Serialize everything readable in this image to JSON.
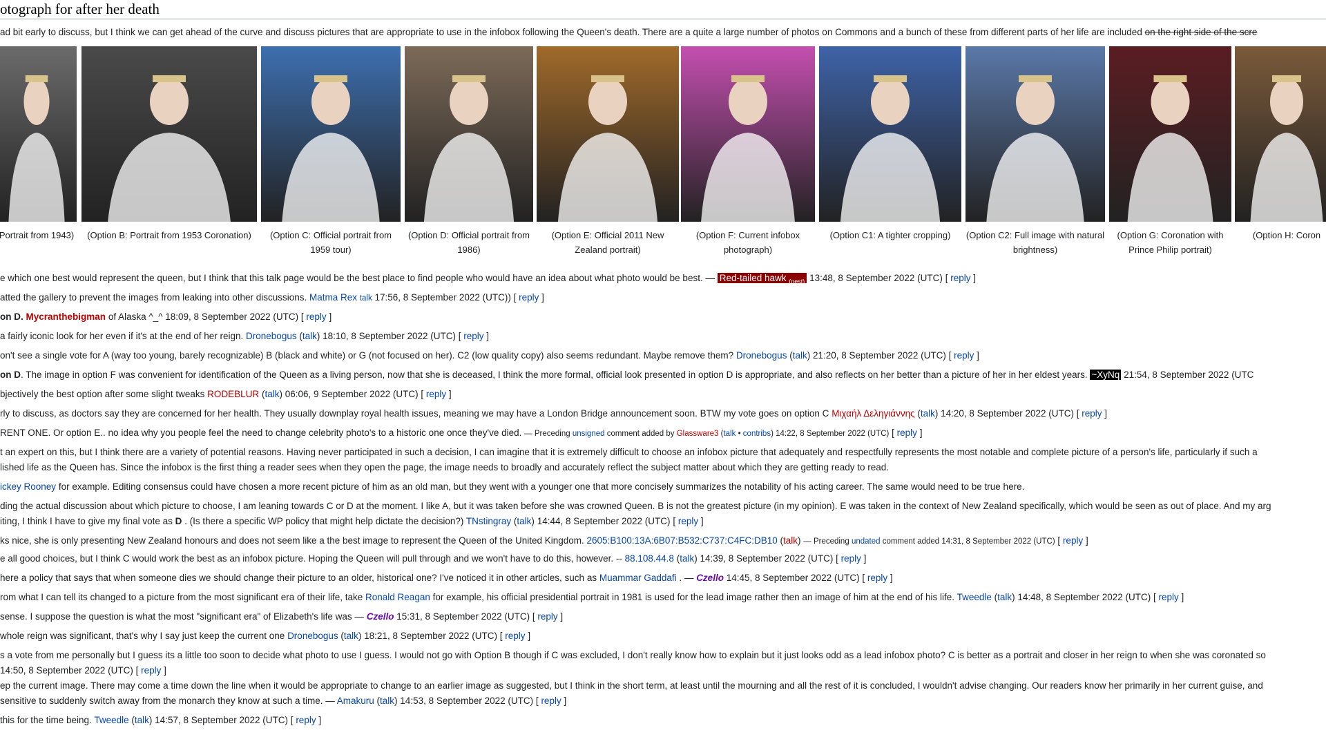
{
  "heading": "otograph for after her death",
  "intro": {
    "text": "ad bit early to discuss, but I think we can get ahead of the curve and discuss pictures that are appropriate to use in the infobox following the Queen's death. There are a quite a large number of photos on Commons and a bunch of these from different parts of her life are included",
    "struck": "on the right side of the scre"
  },
  "gallery": [
    {
      "caption": "Portrait from 1943)",
      "bg": "#6b6b6b"
    },
    {
      "caption": "(Option B: Portrait from 1953 Coronation)",
      "bg": "#4a4a4a"
    },
    {
      "caption": "(Option C: Official portrait from 1959 tour)",
      "bg": "#3d6fb0"
    },
    {
      "caption": "(Option D: Official portrait from 1986)",
      "bg": "#7c6a58"
    },
    {
      "caption": "(Option E: Official 2011 New Zealand portrait)",
      "bg": "#a06a2a"
    },
    {
      "caption": "(Option F: Current infobox photograph)",
      "bg": "#c44fb0"
    },
    {
      "caption": "(Option C1: A tighter cropping)",
      "bg": "#3e63a8"
    },
    {
      "caption": "(Option C2: Full image with natural brightness)",
      "bg": "#5a78a8"
    },
    {
      "caption": "(Option G: Coronation with Prince Philip portrait)",
      "bg": "#5a1d22"
    },
    {
      "caption": "(Option H: Coron",
      "bg": "#7a5a3a"
    }
  ],
  "comments": [
    {
      "text": "e which one best would represent the queen, but I think that this talk page would be the best place to find people who would have an idea about what photo would be best. —",
      "sig": "Red-tailed hawk",
      "sig_sub": "(nest)",
      "time": "13:48, 8 September 2022 (UTC)",
      "reply": "reply"
    },
    {
      "text": "atted the gallery to prevent the images from leaking into other discussions.",
      "user": "Matma Rex",
      "talk": "talk",
      "time": "17:56, 8 September 2022 (UTC))",
      "reply": "reply"
    },
    {
      "bold": "on D.",
      "user": "Mycranthebigman",
      "text2": "of Alaska ^_^ 18:09, 8 September 2022 (UTC)",
      "reply": "reply"
    },
    {
      "text": "a fairly iconic look for her even if it's at the end of her reign.",
      "user": "Dronebogus",
      "talk": "talk",
      "time": "18:10, 8 September 2022 (UTC)",
      "reply": "reply"
    },
    {
      "text": "on't see a single vote for A (way too young, barely recognizable) B (black and white) or G (not focused on her). C2 (low quality copy) also seems redundant. Maybe remove them?",
      "user": "Dronebogus",
      "talk": "talk",
      "time": "21:20, 8 September 2022 (UTC)",
      "reply": "reply"
    },
    {
      "bold": "on D",
      "text": ". The image in option F was convenient for identification of the Queen as a living person, now that she is deceased, I think the more formal, official look presented in option D is appropriate, and also reflects on her better than a picture of her in her eldest years.",
      "sig": "~XyNq",
      "time": "21:54, 8 September 2022 (UTC"
    },
    {
      "text": "bjectively the best option after some slight tweaks",
      "user": "RODEBLUR",
      "talk": "talk",
      "time": "06:06, 9 September 2022 (UTC)",
      "reply": "reply"
    },
    {
      "text": "rly to discuss, as doctors say they are concerned for her health. They usually downplay royal health issues, meaning we may have a London Bridge announcement soon. BTW my vote goes on option C",
      "user": "Μιχαήλ Δεληγιάννης",
      "talk": "talk",
      "time": "14:20, 8 September 2022 (UTC)",
      "reply": "reply"
    },
    {
      "text": "RENT ONE. Or option E.. no idea why you people feel the need to change celebrity photo's to a historic one once they've died.",
      "pre": "— Preceding",
      "unsigned": "unsigned",
      "mid": "comment added by",
      "user": "Glassware3",
      "talk": "talk",
      "contribs": "contribs",
      "time": "14:22, 8 September 2022 (UTC)",
      "reply": "reply"
    },
    {
      "text": "t an expert on this, but I think there are a variety of potential reasons. Having never participated in such a decision, I can imagine that it is extremely difficult to choose an infobox picture that adequately and respectfully represents the most notable and complete picture of a person's life, particularly if such a"
    },
    {
      "text": "lished life as the Queen has. Since the infobox is the first thing a reader sees when they open the page, the image needs to broadly and accurately reflect the subject matter about which they are getting ready to read."
    },
    {
      "link": "ickey Rooney",
      "text": "for example. Editing consensus could have chosen a more recent picture of him as an old man, but they went with a younger one that more concisely summarizes the notability of his acting career. The same would need to be true here."
    },
    {
      "text": "ding the actual discussion about which picture to choose, I am leaning towards C or D at the moment. I like A, but it was taken before she was crowned Queen. B is not the greatest picture (in my opinion). E was taken in the context of New Zealand specifically, which would be seen as out of place. And my arg"
    },
    {
      "text": "iting, I think I have to give my final vote as",
      "bold": "D",
      "text2": ". (Is there a specific WP policy that might help dictate the decision?)",
      "user": "TNstingray",
      "talk": "talk",
      "time": "14:44, 8 September 2022 (UTC)",
      "reply": "reply"
    },
    {
      "text": "ks nice, she is only presenting New Zealand honours and does not seem like a the best image to represent the Queen of the United Kingdom.",
      "user": "2605:B100:13A:6B07:B532:C737:C4FC:DB10",
      "talk": "talk",
      "pre": "— Preceding",
      "unsigned": "undated",
      "mid": "comment added 14:31, 8 September 2022 (UTC)",
      "reply": "reply"
    },
    {
      "text": "e all good choices, but I think C would work the best as an infobox picture. Hoping the Queen will pull through and we won't have to do this, however. --",
      "user": "88.108.44.8",
      "talk": "talk",
      "time": "14:39, 8 September 2022 (UTC)",
      "reply": "reply"
    },
    {
      "text": "here a policy that says that when someone dies we should change their picture to an older, historical one? I've noticed it in other articles, such as",
      "link": "Muammar Gaddafi",
      "text2": ". —",
      "czello": "Czello",
      "time": "14:45, 8 September 2022 (UTC)",
      "reply": "reply"
    },
    {
      "text": "rom what I can tell its changed to a picture from the most significant era of their life, take",
      "link": "Ronald Reagan",
      "text2": "for example, his official presidential portrait in 1981 is used for the lead image rather then an image of him at the end of his life.",
      "user": "Tweedle",
      "talk": "talk",
      "time": "14:48, 8 September 2022 (UTC)",
      "reply": "reply"
    },
    {
      "text": "sense. I suppose the question is what the most \"significant era\" of Elizabeth's life was —",
      "czello": "Czello",
      "time": "15:31, 8 September 2022 (UTC)",
      "reply": "reply"
    },
    {
      "text": "whole reign was significant, that's why I say just keep the current one",
      "user": "Dronebogus",
      "talk": "talk",
      "time": "18:21, 8 September 2022 (UTC)",
      "reply": "reply"
    },
    {
      "text": "s a vote from me personally but I guess its a little too soon to decide what photo to use I guess. I would not go with Option B though if C was excluded, I don't really know how to explain but it just looks odd as a lead infobox photo? C is better as a portrait and closer in her reign to when she was coronated so"
    },
    {
      "text": "14:50, 8 September 2022 (UTC)",
      "reply": "reply"
    },
    {
      "text": "ep the current image. There may come a time down the line when it would be appropriate to change to an earlier image as suggested, but I think in the short term, at least until the mourning and all the rest of it is concluded, I wouldn't advise changing. Our readers know her primarily in her current guise, and"
    },
    {
      "text": "sensitive to suddenly switch away from the monarch they know at such a time.  —",
      "user": "Amakuru",
      "talk": "talk",
      "time": "14:53, 8 September 2022 (UTC)",
      "reply": "reply"
    },
    {
      "text": "this for the time being.",
      "user": "Tweedle",
      "talk": "talk",
      "time": "14:57, 8 September 2022 (UTC)",
      "reply": "reply"
    }
  ]
}
